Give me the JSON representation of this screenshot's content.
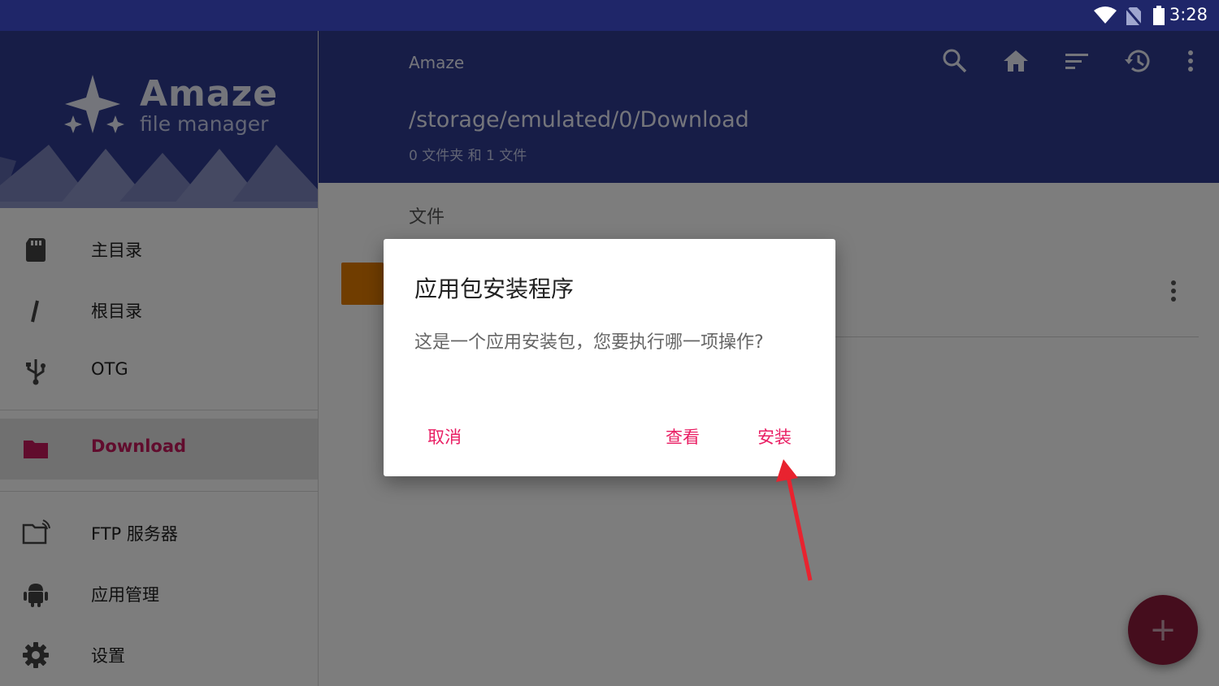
{
  "status_bar": {
    "time": "3:28"
  },
  "drawer": {
    "logo_title": "Amaze",
    "logo_subtitle": "file manager",
    "items": [
      {
        "label": "主目录",
        "icon": "sd-card-icon"
      },
      {
        "label": "根目录",
        "icon": "slash-icon"
      },
      {
        "label": "OTG",
        "icon": "usb-icon"
      },
      {
        "label": "Download",
        "icon": "folder-icon",
        "active": true
      },
      {
        "label": "FTP 服务器",
        "icon": "ftp-folder-icon"
      },
      {
        "label": "应用管理",
        "icon": "android-icon"
      },
      {
        "label": "设置",
        "icon": "gear-icon"
      }
    ]
  },
  "appbar": {
    "title": "Amaze",
    "path": "/storage/emulated/0/Download",
    "summary": "0 文件夹 和 1 文件"
  },
  "content": {
    "section_header": "文件"
  },
  "dialog": {
    "title": "应用包安装程序",
    "message": "这是一个应用安装包，您要执行哪一项操作?",
    "cancel_label": "取消",
    "view_label": "查看",
    "install_label": "安装"
  },
  "fab": {
    "label": "+"
  },
  "colors": {
    "primary": "#2f3a8f",
    "status_bar": "#1f2669",
    "accent": "#e91e63",
    "fab": "#8b1a3b",
    "active_item": "#c2185b"
  }
}
